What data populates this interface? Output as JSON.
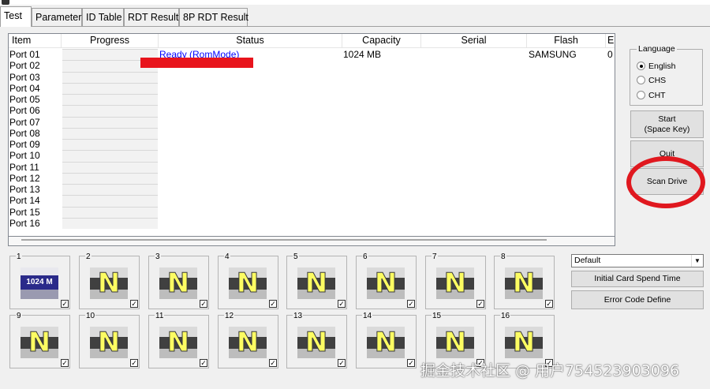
{
  "tabs": [
    {
      "label": "Test",
      "active": true
    },
    {
      "label": "Parameter",
      "active": false
    },
    {
      "label": "ID Table",
      "active": false
    },
    {
      "label": "RDT Result",
      "active": false
    },
    {
      "label": "8P RDT Result",
      "active": false
    }
  ],
  "list": {
    "columns": [
      "Item",
      "Progress",
      "Status",
      "Capacity",
      "Serial",
      "Flash",
      "E"
    ],
    "rows": [
      {
        "port": "Port 01",
        "status": "Ready (RomMode)",
        "capacity": "1024 MB",
        "serial": "",
        "flash": "SAMSUNG",
        "extra": "0"
      },
      {
        "port": "Port 02",
        "status": "",
        "capacity": "",
        "serial": "",
        "flash": "",
        "extra": ""
      },
      {
        "port": "Port 03",
        "status": "",
        "capacity": "",
        "serial": "",
        "flash": "",
        "extra": ""
      },
      {
        "port": "Port 04",
        "status": "",
        "capacity": "",
        "serial": "",
        "flash": "",
        "extra": ""
      },
      {
        "port": "Port 05",
        "status": "",
        "capacity": "",
        "serial": "",
        "flash": "",
        "extra": ""
      },
      {
        "port": "Port 06",
        "status": "",
        "capacity": "",
        "serial": "",
        "flash": "",
        "extra": ""
      },
      {
        "port": "Port 07",
        "status": "",
        "capacity": "",
        "serial": "",
        "flash": "",
        "extra": ""
      },
      {
        "port": "Port 08",
        "status": "",
        "capacity": "",
        "serial": "",
        "flash": "",
        "extra": ""
      },
      {
        "port": "Port 09",
        "status": "",
        "capacity": "",
        "serial": "",
        "flash": "",
        "extra": ""
      },
      {
        "port": "Port 10",
        "status": "",
        "capacity": "",
        "serial": "",
        "flash": "",
        "extra": ""
      },
      {
        "port": "Port 11",
        "status": "",
        "capacity": "",
        "serial": "",
        "flash": "",
        "extra": ""
      },
      {
        "port": "Port 12",
        "status": "",
        "capacity": "",
        "serial": "",
        "flash": "",
        "extra": ""
      },
      {
        "port": "Port 13",
        "status": "",
        "capacity": "",
        "serial": "",
        "flash": "",
        "extra": ""
      },
      {
        "port": "Port 14",
        "status": "",
        "capacity": "",
        "serial": "",
        "flash": "",
        "extra": ""
      },
      {
        "port": "Port 15",
        "status": "",
        "capacity": "",
        "serial": "",
        "flash": "",
        "extra": ""
      },
      {
        "port": "Port 16",
        "status": "",
        "capacity": "",
        "serial": "",
        "flash": "",
        "extra": ""
      }
    ]
  },
  "language": {
    "title": "Language",
    "options": [
      {
        "label": "English",
        "selected": true
      },
      {
        "label": "CHS",
        "selected": false
      },
      {
        "label": "CHT",
        "selected": false
      }
    ]
  },
  "buttons": {
    "start_line1": "Start",
    "start_line2": "(Space Key)",
    "quit": "Quit",
    "scan_drive": "Scan Drive",
    "initial_card_spend_time": "Initial Card Spend Time",
    "error_code_define": "Error Code Define"
  },
  "profile_select": {
    "value": "Default"
  },
  "drives": [
    {
      "number": "1",
      "icon": "card-1024m-icon",
      "label": "1024 M",
      "checked": true
    },
    {
      "number": "2",
      "icon": "no-drive-n-icon",
      "label": "N",
      "checked": true
    },
    {
      "number": "3",
      "icon": "no-drive-n-icon",
      "label": "N",
      "checked": true
    },
    {
      "number": "4",
      "icon": "no-drive-n-icon",
      "label": "N",
      "checked": true
    },
    {
      "number": "5",
      "icon": "no-drive-n-icon",
      "label": "N",
      "checked": true
    },
    {
      "number": "6",
      "icon": "no-drive-n-icon",
      "label": "N",
      "checked": true
    },
    {
      "number": "7",
      "icon": "no-drive-n-icon",
      "label": "N",
      "checked": true
    },
    {
      "number": "8",
      "icon": "no-drive-n-icon",
      "label": "N",
      "checked": true
    },
    {
      "number": "9",
      "icon": "no-drive-n-icon",
      "label": "N",
      "checked": true
    },
    {
      "number": "10",
      "icon": "no-drive-n-icon",
      "label": "N",
      "checked": true
    },
    {
      "number": "11",
      "icon": "no-drive-n-icon",
      "label": "N",
      "checked": true
    },
    {
      "number": "12",
      "icon": "no-drive-n-icon",
      "label": "N",
      "checked": true
    },
    {
      "number": "13",
      "icon": "no-drive-n-icon",
      "label": "N",
      "checked": true
    },
    {
      "number": "14",
      "icon": "no-drive-n-icon",
      "label": "N",
      "checked": true
    },
    {
      "number": "15",
      "icon": "no-drive-n-icon",
      "label": "N",
      "checked": true
    },
    {
      "number": "16",
      "icon": "no-drive-n-icon",
      "label": "N",
      "checked": true
    }
  ],
  "watermark": "掘金技术社区 @ 用户754523903096",
  "colors": {
    "annotation_red": "#e0181f",
    "status_blue": "#0000ff",
    "n_letter": "#fcfc62"
  }
}
